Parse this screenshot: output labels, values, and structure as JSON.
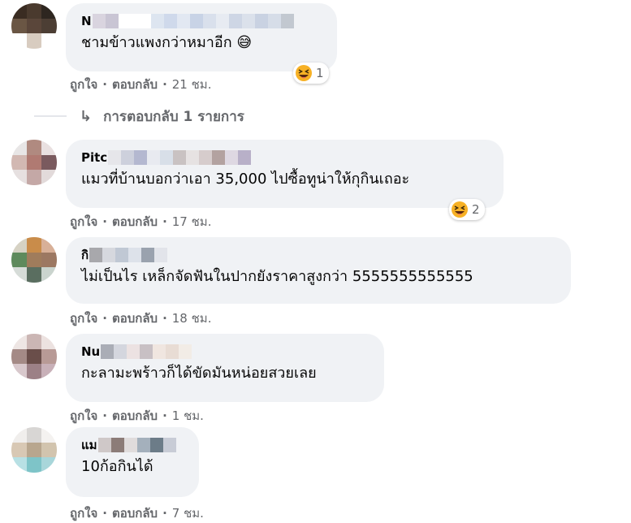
{
  "comments": [
    {
      "author_prefix": "N",
      "text": "ชามข้าวแพงกว่าหมาอีก",
      "emoji": "😅",
      "reaction_count": "1",
      "like_label": "ถูกใจ",
      "reply_label": "ตอบกลับ",
      "time": "21 ชม."
    },
    {
      "author_prefix": "Pitc",
      "text": "แมวที่บ้านบอกว่าเอา 35,000 ไปซื้อทูน่าให้กุกินเถอะ",
      "reaction_count": "2",
      "like_label": "ถูกใจ",
      "reply_label": "ตอบกลับ",
      "time": "17 ชม."
    },
    {
      "author_prefix": "กิ",
      "text": "ไม่เป็นไร เหล็กจัดฟันในปากยังราคาสูงกว่า 5555555555555",
      "like_label": "ถูกใจ",
      "reply_label": "ตอบกลับ",
      "time": "18 ชม."
    },
    {
      "author_prefix": "Nu",
      "text": "กะลามะพร้าวก็ได้ขัดมันหน่อยสวยเลย",
      "like_label": "ถูกใจ",
      "reply_label": "ตอบกลับ",
      "time": "1 ชม."
    },
    {
      "author_prefix": "แม",
      "text": "10ก้อกินได้",
      "like_label": "ถูกใจ",
      "reply_label": "ตอบกลับ",
      "time": "7 ชม."
    }
  ],
  "replies": {
    "label": "การตอบกลับ 1 รายการ"
  },
  "colors": {
    "bubble": "#f0f2f5",
    "secondary_text": "#65676b",
    "reaction_face": "#f7b125"
  },
  "icons": {
    "reaction": "laughing-emoji-icon",
    "reply_arrow": "reply-arrow-icon"
  }
}
